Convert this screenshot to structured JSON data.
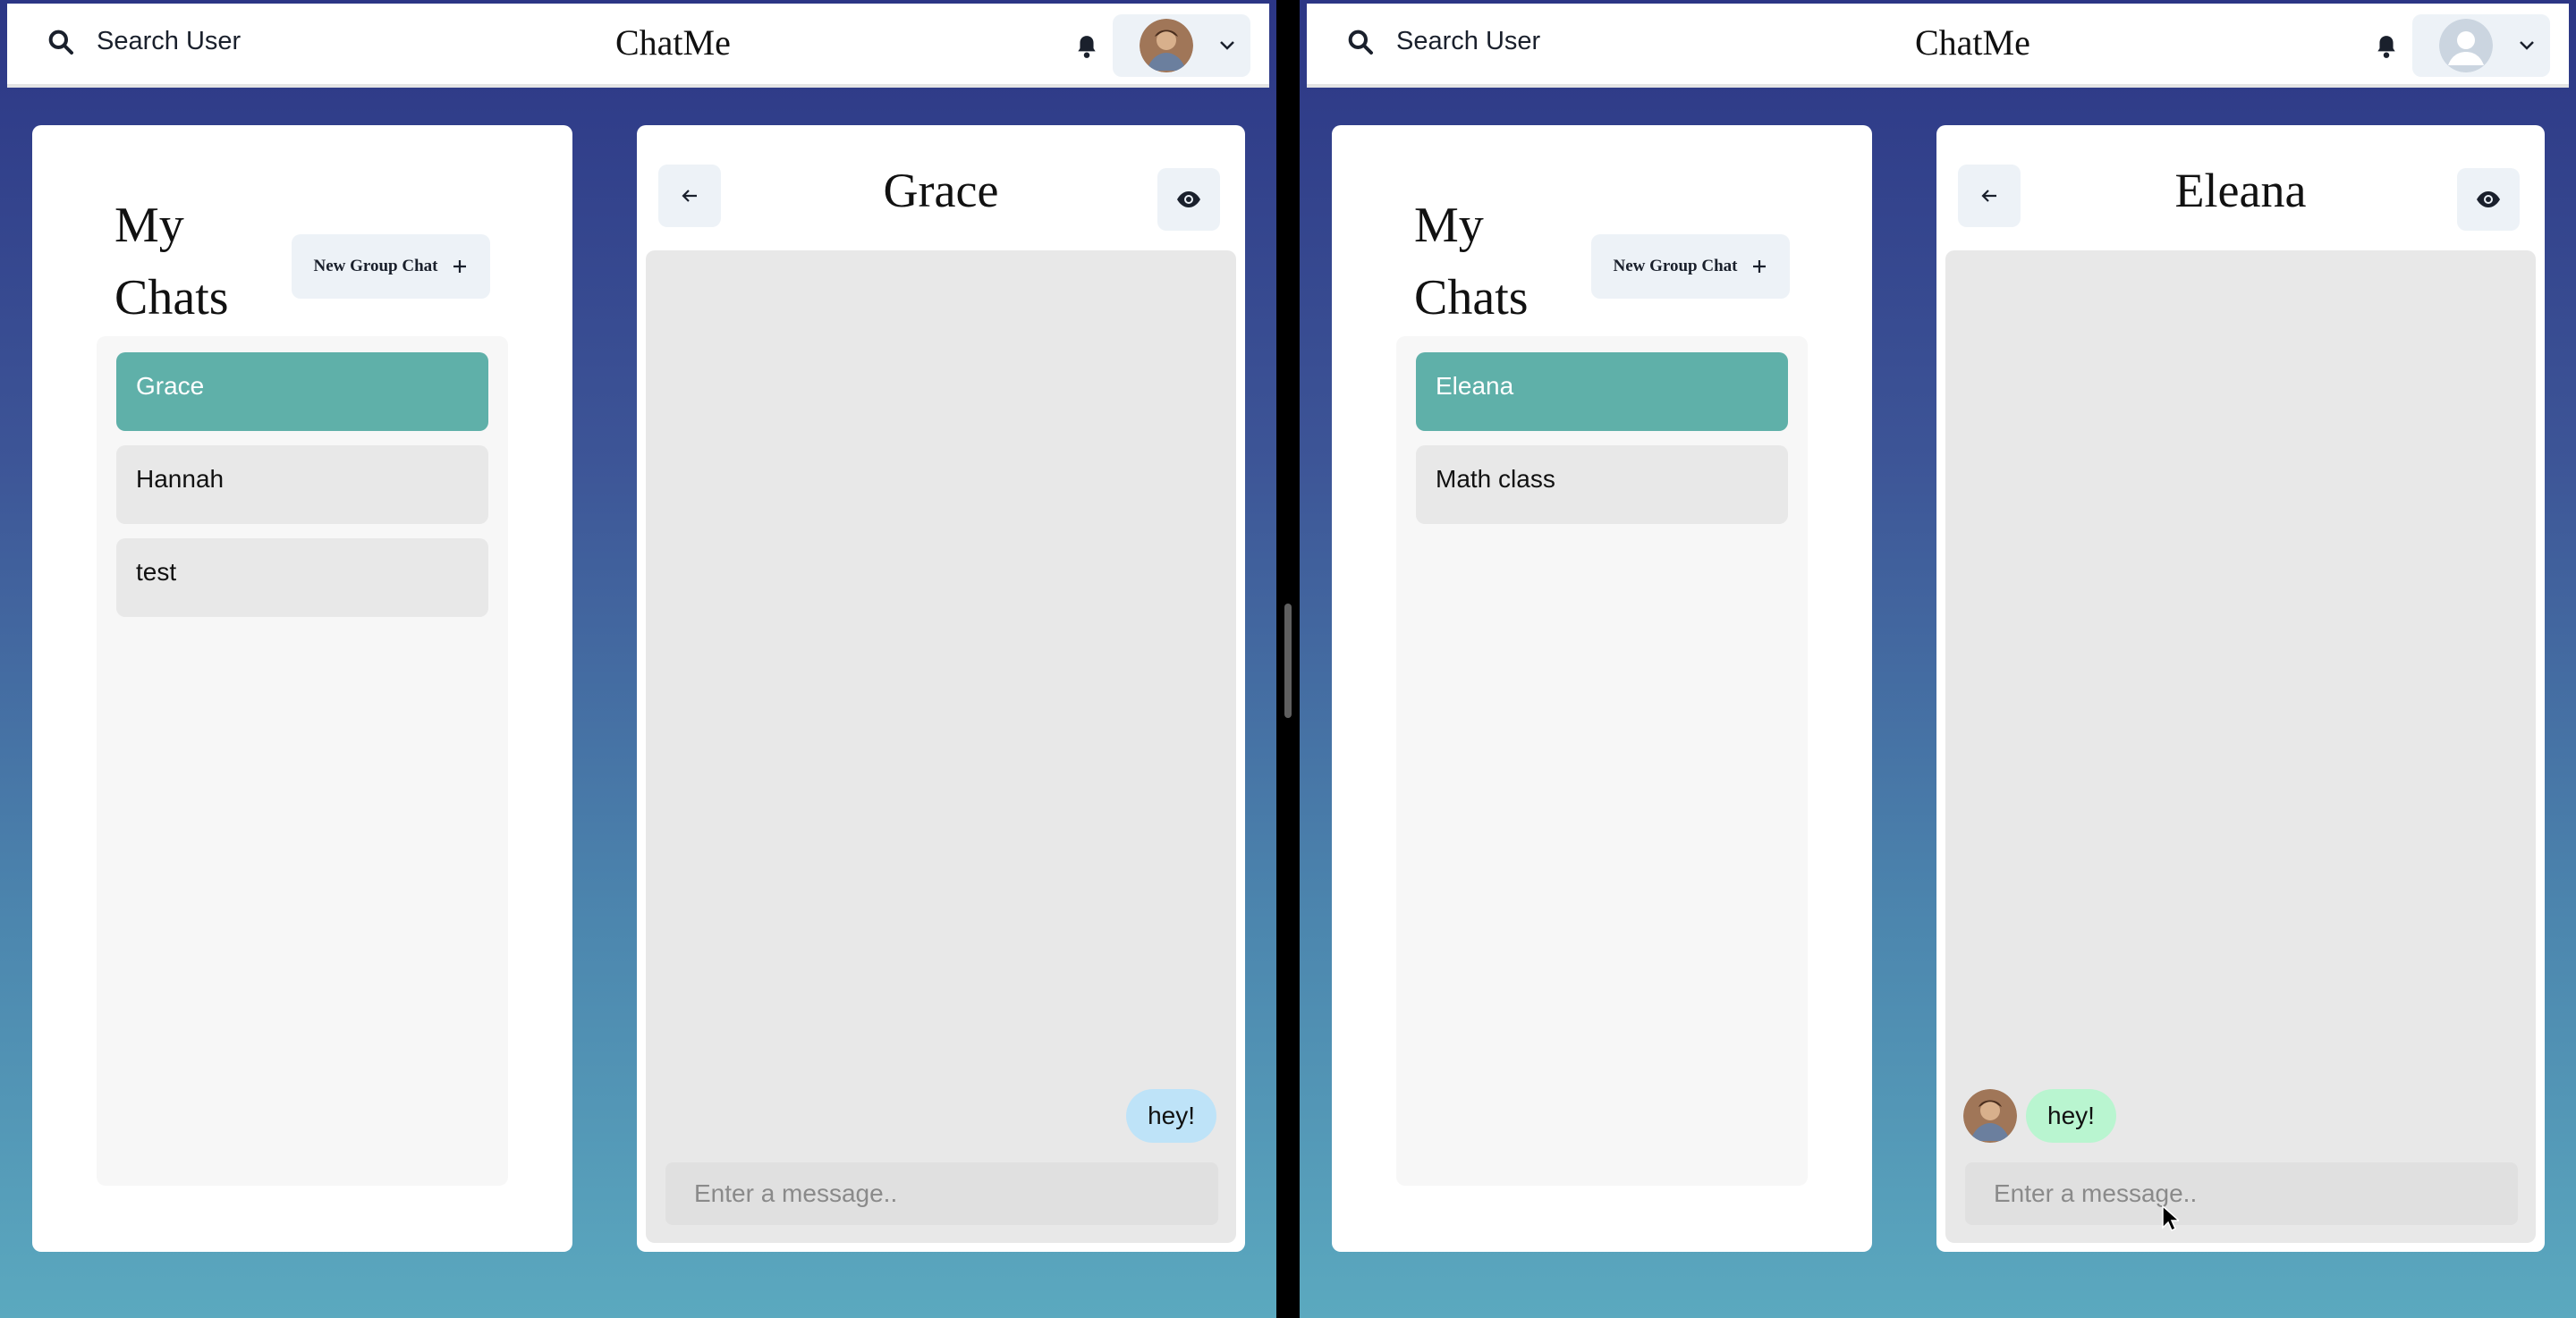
{
  "left": {
    "header": {
      "search_label": "Search User",
      "brand": "ChatMe",
      "avatar_kind": "photo"
    },
    "sidebar": {
      "title": "My Chats",
      "new_group_label": "New Group Chat",
      "chats": [
        {
          "label": "Grace",
          "active": true
        },
        {
          "label": "Hannah",
          "active": false
        },
        {
          "label": "test",
          "active": false
        }
      ]
    },
    "chat": {
      "name": "Grace",
      "messages": [
        {
          "text": "hey!",
          "direction": "sent"
        }
      ],
      "input_placeholder": "Enter a message.."
    }
  },
  "right": {
    "header": {
      "search_label": "Search User",
      "brand": "ChatMe",
      "avatar_kind": "default"
    },
    "sidebar": {
      "title": "My Chats",
      "new_group_label": "New Group Chat",
      "chats": [
        {
          "label": "Eleana",
          "active": true
        },
        {
          "label": "Math class",
          "active": false
        }
      ]
    },
    "chat": {
      "name": "Eleana",
      "messages": [
        {
          "text": "hey!",
          "direction": "received"
        }
      ],
      "input_placeholder": "Enter a message.."
    }
  },
  "colors": {
    "active_chat": "#5fb0a9",
    "sent_bubble": "#bee3f8",
    "received_bubble": "#b9f5d0",
    "gradient_top": "#2c3685",
    "gradient_bottom": "#5ba9bf"
  },
  "icons": {
    "search": "search-icon",
    "bell": "bell-icon",
    "chevron": "chevron-down-icon",
    "plus": "plus-icon",
    "back": "arrow-left-icon",
    "view": "eye-icon",
    "cursor": "mouse-cursor"
  }
}
